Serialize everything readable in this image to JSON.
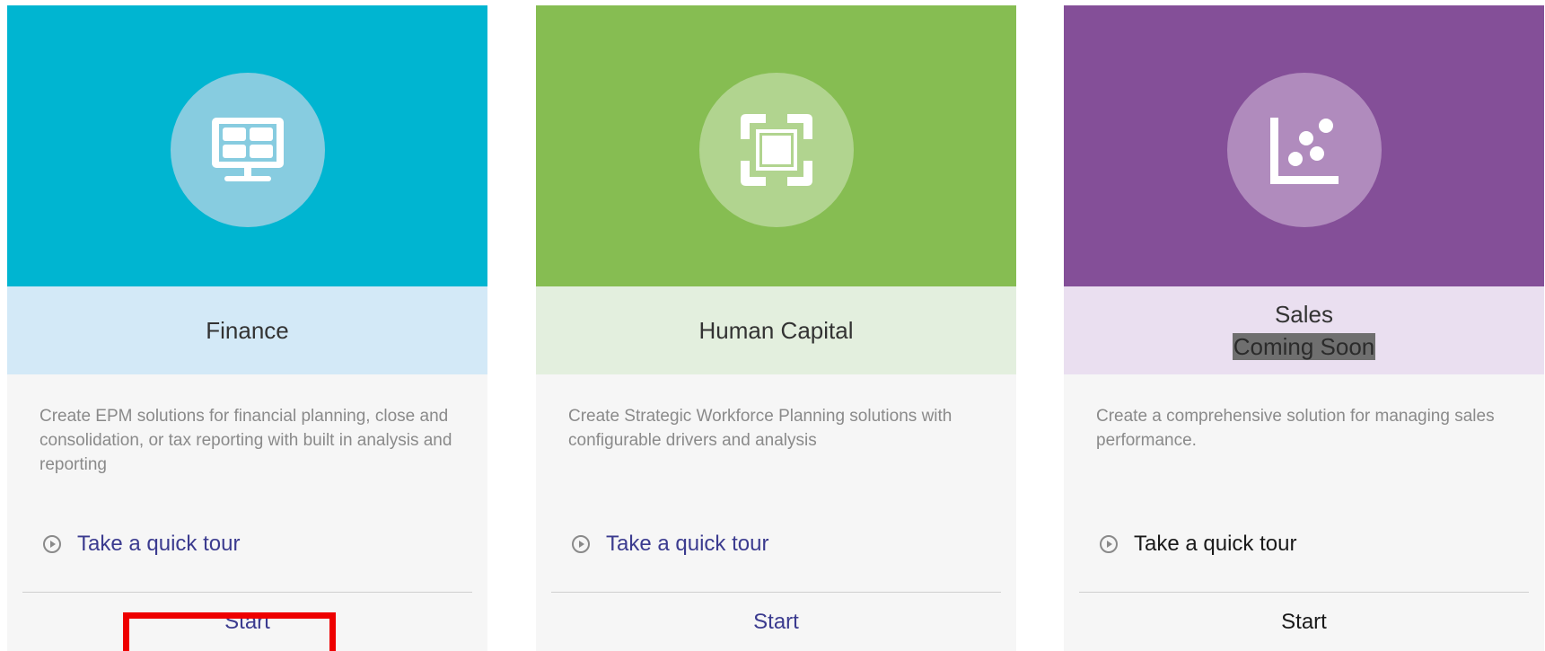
{
  "cards": [
    {
      "title": "Finance",
      "subtitle": "",
      "description": "Create EPM solutions for financial planning, close and consolidation, or tax reporting with built in analysis and reporting",
      "tour_label": "Take a quick tour",
      "start_label": "Start",
      "icon": "monitor-dashboard-icon",
      "colors": {
        "banner": "#00b5d1",
        "circle": "#87cce0",
        "band": "#d3e9f7"
      }
    },
    {
      "title": "Human Capital",
      "subtitle": "",
      "description": "Create Strategic Workforce Planning solutions with configurable drivers and analysis",
      "tour_label": "Take a quick tour",
      "start_label": "Start",
      "icon": "frame-focus-icon",
      "colors": {
        "banner": "#86bd52",
        "circle": "#b1d48f",
        "band": "#e3efde"
      }
    },
    {
      "title": "Sales",
      "subtitle": "Coming Soon",
      "description": "Create a comprehensive solution for managing sales performance.",
      "tour_label": "Take a quick tour",
      "start_label": "Start",
      "icon": "scatter-plot-icon",
      "colors": {
        "banner": "#844f98",
        "circle": "#b08bbd",
        "band": "#eadff0"
      }
    }
  ]
}
